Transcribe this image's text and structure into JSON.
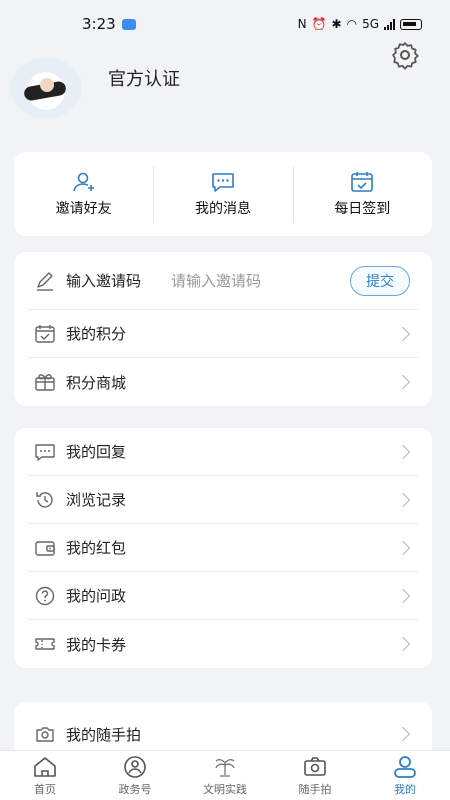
{
  "status_bar": {
    "time": "3:23",
    "network": "5G"
  },
  "profile": {
    "name": "官方认证"
  },
  "quick_actions": [
    {
      "label": "邀请好友",
      "icon": "add-user-icon"
    },
    {
      "label": "我的消息",
      "icon": "message-icon"
    },
    {
      "label": "每日签到",
      "icon": "calendar-checkin-icon"
    }
  ],
  "invite": {
    "label": "输入邀请码",
    "placeholder": "请输入邀请码",
    "submit_label": "提交"
  },
  "section1": [
    {
      "label": "我的积分",
      "icon": "points-icon"
    },
    {
      "label": "积分商城",
      "icon": "mall-icon"
    }
  ],
  "section2": [
    {
      "label": "我的回复",
      "icon": "reply-icon"
    },
    {
      "label": "浏览记录",
      "icon": "history-icon"
    },
    {
      "label": "我的红包",
      "icon": "wallet-icon"
    },
    {
      "label": "我的问政",
      "icon": "question-icon"
    },
    {
      "label": "我的卡券",
      "icon": "coupon-icon"
    }
  ],
  "section3": [
    {
      "label": "我的随手拍",
      "icon": "camera-icon"
    }
  ],
  "tabs": [
    {
      "label": "首页",
      "icon": "home-icon",
      "active": false
    },
    {
      "label": "政务号",
      "icon": "gov-account-icon",
      "active": false
    },
    {
      "label": "文明实践",
      "icon": "civilization-icon",
      "active": false
    },
    {
      "label": "随手拍",
      "icon": "camera-tab-icon",
      "active": false
    },
    {
      "label": "我的",
      "icon": "profile-icon",
      "active": true
    }
  ],
  "colors": {
    "accent": "#2f7fc4",
    "background": "#f2f3f5",
    "card": "#ffffff"
  }
}
